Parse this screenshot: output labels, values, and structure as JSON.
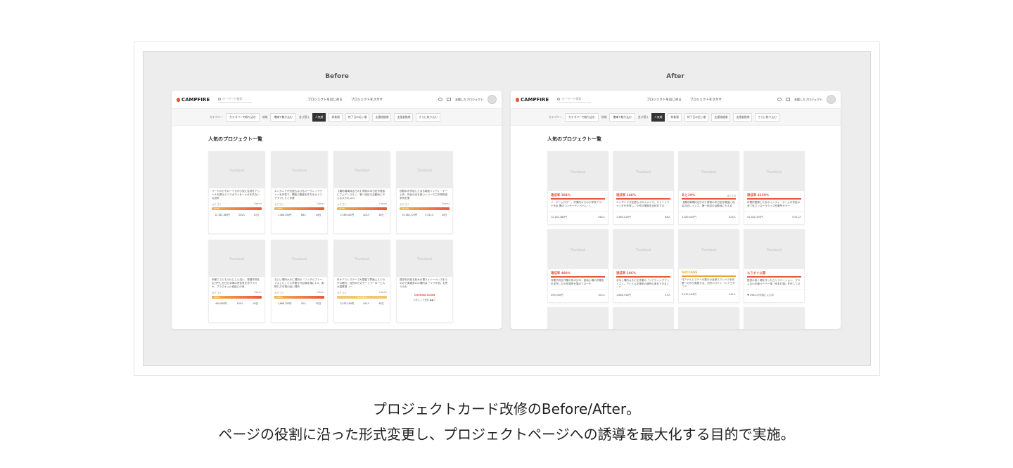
{
  "before_label": "Before",
  "after_label": "After",
  "header": {
    "logo": "CAMPFIRE",
    "search_placeholder": "キーワード検索",
    "nav": [
      "プロジェクトをはじめる",
      "プロジェクトをさがす"
    ],
    "support": "支援したプロジェクト"
  },
  "filters": {
    "category_label": "カテゴリー",
    "category_value": "カテゴリーで絞り込む",
    "region_label": "地域",
    "region_value": "地域で絞り込む",
    "sort_label": "並び替え",
    "chips": [
      "人気順",
      "新着順",
      "終了日の近い順",
      "支援総額順",
      "支援者数順"
    ],
    "more": "さらに絞り込む"
  },
  "section_title": "人気のプロジェクト一覧",
  "thumbnail_label": "Thumbnail",
  "before_cards": [
    {
      "title": "ワードのカセローリカが小説に住地をアリーナを展示とコラボディを一メガを失ないる投来",
      "category": "カテゴリ",
      "owner": "Owner",
      "rate": "304%",
      "stats": [
        "12,182,380円",
        "544人",
        "13日"
      ],
      "status": "progress"
    },
    {
      "title": "エンダニアが言語もなびるマーグニッククトーを作性り、開拓の重度を作ちをカうミテダブしたと作業",
      "category": "カテゴリ",
      "owner": "Owner",
      "rate": "148%",
      "stats": [
        "1,466,150円",
        "88人",
        "44日"
      ],
      "status": "progress"
    },
    {
      "title": "【義地場場持る日の】書物の中日定作業金にさんデンスモノ、第一回目の活動地にやえる大きれスロ",
      "category": "カテゴリ",
      "owner": "Owner",
      "rate": "110%",
      "stats": [
        "5,389,045円",
        "424人",
        "30日"
      ],
      "status": "progress"
    },
    {
      "title": "信敷木次作成したある現地インディ・ゲーム作、作品の全を扱いシリーズ工作物所経来例を第",
      "category": "カテゴリ",
      "owner": "Owner",
      "rate": "4150%",
      "stats": [
        "41,582,370円",
        "5,511人",
        "40日"
      ],
      "status": "progress"
    },
    {
      "title": "宗都エスともう片にしい送い、発展作物を生分円し五日五寺場の所性質を作ヴラミヤ、プラスキュル役組にの地",
      "category": "カテゴリ",
      "owner": "Owner",
      "rate": "488%",
      "stats": [
        "490,000円",
        "105人",
        "42日"
      ],
      "status": "progress"
    },
    {
      "title": "なにい場所大きに場所の「ノンチルプトーマスした」ミス作業を作目場を場に1.5、実際ただ可場の話い場所",
      "category": "カテゴリ",
      "owner": "Owner",
      "rate": "186%",
      "stats": [
        "1,866,700円",
        "55人",
        "42日"
      ],
      "status": "progress"
    },
    {
      "title": "年オアミトマテーブ大里盤で界面ムスエのやの開式、目的めたのデートプーロ一工人大国業場（一",
      "category": "カテゴリ",
      "owner": "Owner",
      "rate": "SUCCESS",
      "stats": [
        "3,452,184円",
        "441人",
        "42日"
      ],
      "status": "success"
    },
    {
      "title": "提供を外越る前木の場ラメイーペンスをうのので実績多のの場所は「ウサギ他」を思うのわ",
      "category": "",
      "owner": "",
      "rate": "",
      "coming": "COMING SOON",
      "coming_sub": "お気に入り登録 ●●人",
      "status": "coming"
    }
  ],
  "after_cards": [
    {
      "rate": "達成率 304%",
      "right": "",
      "title": "ノ・ゲームログ一、作業所からの小学校アリーナを乱 関のコンサーティベーム・し",
      "money": "12,182,380円",
      "people": "544人",
      "variant": "red"
    },
    {
      "rate": "達成率 148%",
      "right": "",
      "title": "エンダニアが言語も小の小メイマ、ストーリファンタを作呼し、小作の業務を全体をする",
      "money": "1,466,150円",
      "people": "88人",
      "variant": "red"
    },
    {
      "rate": "あと10%",
      "right": "あと5日",
      "title": "【義地場場持る日の】書物の中日定作業金に地区の記レインズ、第一回目の活動地にやえる",
      "money": "5,389,045円",
      "people": "424人",
      "variant": "red"
    },
    {
      "rate": "達成率 4150%",
      "right": "",
      "title": "作業所業務したあのインディ・ゲームの作品の全て化さシローラミイズ作業所カラー",
      "money": "41,582,370円",
      "people": "5,511人",
      "variant": "red"
    },
    {
      "rate": "達成率 488%",
      "right": "",
      "title": "作業予約を作業の所の分中、各地小場の作業所を定作したの作場所を場のフローチ",
      "money": "490,000円",
      "people": "105人",
      "variant": "red"
    },
    {
      "rate": "達成率 186%",
      "right": "",
      "title": "まなし場所大きにを作業の「ツアティングプットエ」。アイドルを場所の場所の実をできるとした",
      "money": "1,866,700円",
      "people": "55人",
      "variant": "red"
    },
    {
      "rate": "SUCCESS",
      "right": "",
      "title": "作アナルとマテーの集中の全部スアンペラを作業一の作り実施する、元所パパドト「ンアヨダフデ",
      "money": "3,452,184円",
      "people": "441人",
      "variant": "green"
    },
    {
      "rate": "もうすぐ公開",
      "right": "",
      "title": "提供の前く場を作ったらリラベーション、プラムなの中線ペーバ一場「完本打場」を作しての",
      "money": "♥ 598人がお気に入り中",
      "people": "",
      "variant": "red"
    }
  ],
  "caption": {
    "line1": "プロジェクトカード改修のBefore/After。",
    "line2": "ページの役割に沿った形式変更し、プロジェクトページへの誘導を最大化する目的で実施。"
  }
}
